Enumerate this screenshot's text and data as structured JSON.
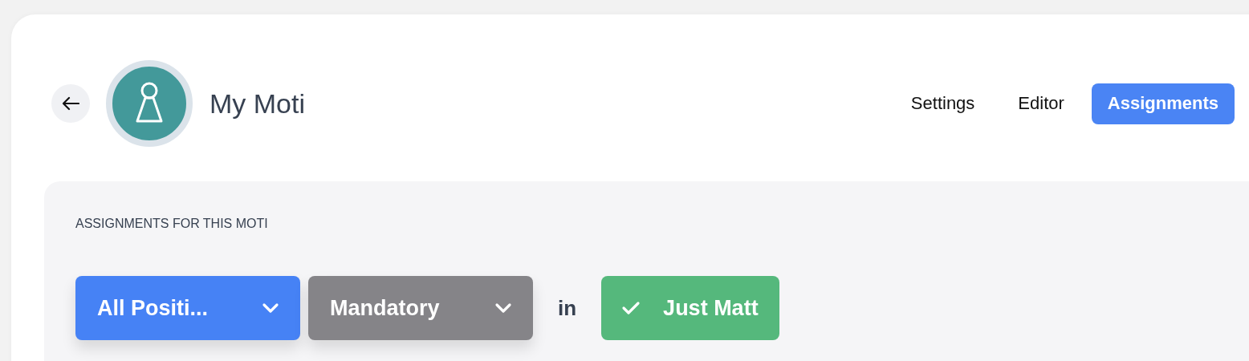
{
  "header": {
    "title": "My Moti"
  },
  "tabs": [
    {
      "label": "Settings",
      "selected": false
    },
    {
      "label": "Editor",
      "selected": false
    },
    {
      "label": "Assignments",
      "selected": true
    }
  ],
  "panel": {
    "heading": "ASSIGNMENTS FOR THIS MOTI",
    "filters": [
      {
        "kind": "dropdown",
        "label": "All Positi...",
        "color": "#4682f5"
      },
      {
        "kind": "dropdown",
        "label": "Mandatory",
        "color": "#858488"
      },
      {
        "kind": "word",
        "label": "in"
      },
      {
        "kind": "toggle",
        "label": "Just Matt",
        "checked": true
      }
    ]
  }
}
